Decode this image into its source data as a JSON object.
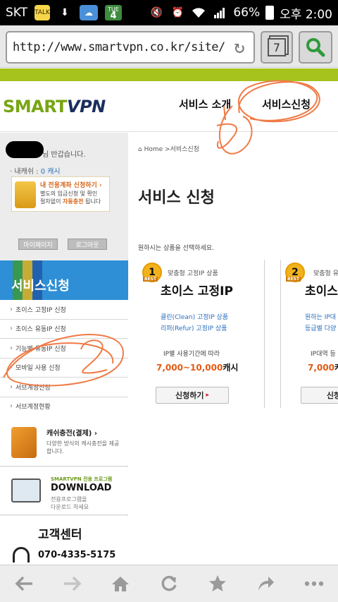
{
  "statusbar": {
    "carrier": "SKT",
    "talk_icon_text": "TALK",
    "cal_day": "TUE",
    "cal_date": "4",
    "battery": "66%",
    "time": "오후 2:00"
  },
  "browser": {
    "url": "http://www.smartvpn.co.kr/site/...",
    "tab_count": "7"
  },
  "site": {
    "logo_smart": "SMART",
    "logo_vpn": "VPN",
    "nav": [
      "서비스 소개",
      "서비스신청"
    ],
    "accent_color": "#a6c21d",
    "brand_blue": "#2e8fd6"
  },
  "sidebar": {
    "greeting": "님 반갑습니다.",
    "cash_label": "· 내캐쉬 : ",
    "cash_value": "0 캐시",
    "promo_title": "내 전용계좌 신청하기 ›",
    "promo_text1": "별도의 입금신청 및 확인",
    "promo_text2": "절차없이 ",
    "promo_highlight": "자동충전",
    "promo_text3": " 됩니다",
    "mypage_button": "마이페이지",
    "logout_button": "로그아웃",
    "section_title": "서비스신청",
    "menu": [
      "초이스 고정IP 신청",
      "초이스 유동IP 신청",
      "기능별 유동IP 신청",
      "모바일 사용 신청",
      "서브계정신청",
      "서브계정현황"
    ],
    "charge_title": "캐쉬충전(결제) ›",
    "charge_text": "다양한 방식의 캐시충전을 제공합니다.",
    "download_brand": "SMARTVPN 전용 프로그램",
    "download_title": "DOWNLOAD",
    "download_text1": "전용프로그램을",
    "download_text2": "다운로드 하세요",
    "cs_title": "고객센터",
    "cs_phone": "070-4335-5175"
  },
  "main": {
    "breadcrumb": "Home >서비스신청",
    "title": "서비스 신청",
    "instruction": "원하시는 상품을 선택하세요.",
    "cards": [
      {
        "badge": "1",
        "best": "BEST",
        "subtitle": "맞춤형 고정IP 상품",
        "name": "초이스 고정IP",
        "desc1": "클린(Clean) 고정IP 상품",
        "desc2": "리퍼(Refur) 고정IP 상품",
        "price_note": "IP별 사용기간에 따라",
        "price_num": "7,000~10,000",
        "price_unit": "캐시",
        "button": "신청하기"
      },
      {
        "badge": "2",
        "best": "BEST",
        "subtitle": "맞춤형 유",
        "name": "초이스",
        "desc1": "원하는 IP대",
        "desc2": "등급별 다양",
        "price_note": "IP대역 등",
        "price_num": "7,000",
        "price_unit": "캐",
        "button": "신청하"
      }
    ]
  }
}
